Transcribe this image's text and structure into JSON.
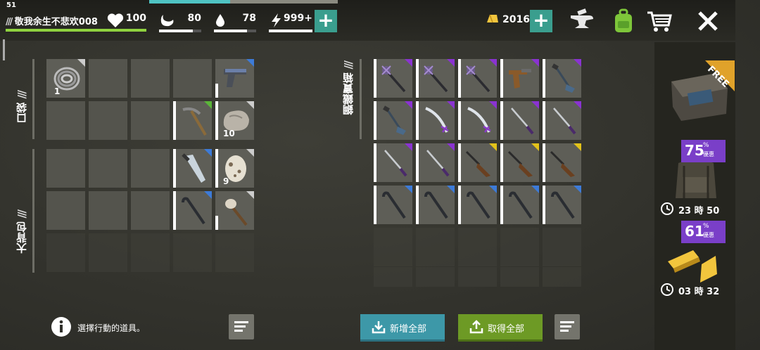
{
  "status": {
    "clock": "51",
    "player_name": "敬我余生不悲欢008",
    "health": "100",
    "food": "80",
    "water": "78",
    "energy": "999+",
    "gold": "2016",
    "health_level": 1.0,
    "food_level": 0.8,
    "water_level": 0.78,
    "energy_level": 1.0,
    "day_progress": 0.43
  },
  "sections": {
    "pocket": "口袋",
    "backpack": "大背包",
    "chest": "鋼鐵寶箱"
  },
  "pocket_items": [
    {
      "icon": "wire-coil-icon",
      "qty": "1",
      "rarity": "gray"
    },
    {
      "icon": "pistol-icon",
      "qty": "",
      "rarity": "blue"
    },
    {
      "icon": "pickaxe-icon",
      "qty": "",
      "rarity": "green"
    },
    {
      "icon": "stone-icon",
      "qty": "10",
      "rarity": "gray"
    }
  ],
  "backpack_items": [
    {
      "icon": "machete-icon",
      "qty": "",
      "rarity": "blue"
    },
    {
      "icon": "egg-icon",
      "qty": "9",
      "rarity": "gray"
    },
    {
      "icon": "crowbar-icon",
      "qty": "",
      "rarity": "blue"
    },
    {
      "icon": "torch-icon",
      "qty": "",
      "rarity": "gray"
    }
  ],
  "chest_items": [
    [
      "mace-icon",
      "mace-icon",
      "mace-icon",
      "crossbow-pistol-icon",
      "shovel-icon"
    ],
    [
      "shovel-icon",
      "serrated-sword-icon",
      "serrated-sword-icon",
      "katana-icon",
      "katana-icon"
    ],
    [
      "katana-icon",
      "katana-icon",
      "shotgun-icon",
      "shotgun-icon",
      "shotgun-icon"
    ],
    [
      "crowbar-icon",
      "crowbar-icon",
      "crowbar-icon",
      "crowbar-icon",
      "crowbar-icon"
    ]
  ],
  "chest_rarity": [
    [
      "purple",
      "purple",
      "purple",
      "purple",
      "purple"
    ],
    [
      "purple",
      "purple",
      "purple",
      "purple",
      "purple"
    ],
    [
      "purple",
      "purple",
      "yellow",
      "yellow",
      "yellow"
    ],
    [
      "blue",
      "blue",
      "blue",
      "blue",
      "blue"
    ]
  ],
  "hint": "選擇行動的道具。",
  "buttons": {
    "add_all": "新增全部",
    "take_all": "取得全部"
  },
  "shop": {
    "free_label": "FREE",
    "offer1_pct": "75",
    "offer1_unit": "%",
    "offer1_tag": "優惠",
    "offer1_timer": "23 時 50",
    "offer2_pct": "61",
    "offer2_unit": "%",
    "offer2_tag": "優惠",
    "offer2_timer": "03 時 32"
  },
  "colors": {
    "accent_teal": "#3a9e8e",
    "accent_green": "#6b8e23",
    "purple": "#8a33d1",
    "blue": "#3d7bd8",
    "yellow": "#e2c21a"
  }
}
